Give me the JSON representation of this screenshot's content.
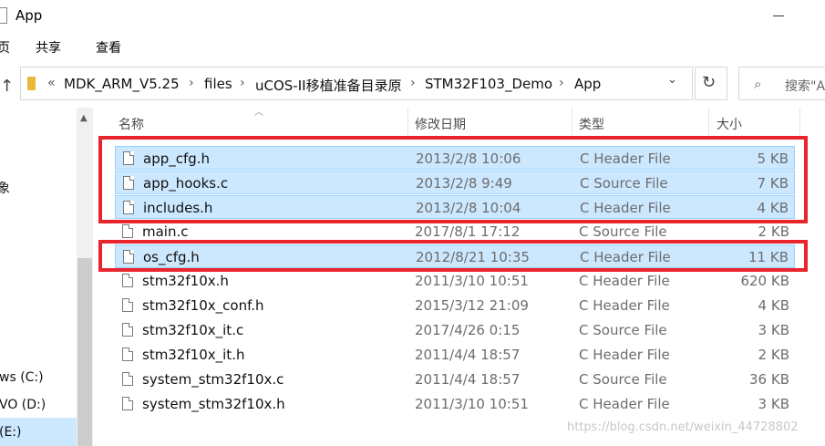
{
  "window": {
    "title": "App"
  },
  "ribbon": {
    "tabs": [
      "页",
      "共享",
      "查看"
    ]
  },
  "address": {
    "lead": "«",
    "crumbs": [
      "MDK_ARM_V5.25",
      "files",
      "uCOS-II移植准备目录原",
      "STM32F103_Demo",
      "App"
    ]
  },
  "search": {
    "placeholder": "搜索\"A"
  },
  "nav": {
    "items": [
      "象",
      "ws (C:)",
      "VO (D:)",
      "(E:)"
    ]
  },
  "columns": {
    "name": "名称",
    "date": "修改日期",
    "type": "类型",
    "size": "大小"
  },
  "files": [
    {
      "name": "app_cfg.h",
      "date": "2013/2/8 10:06",
      "type": "C Header File",
      "size": "5 KB"
    },
    {
      "name": "app_hooks.c",
      "date": "2013/2/8 9:49",
      "type": "C Source File",
      "size": "7 KB"
    },
    {
      "name": "includes.h",
      "date": "2013/2/8 10:04",
      "type": "C Header File",
      "size": "4 KB"
    },
    {
      "name": "main.c",
      "date": "2017/8/1 17:12",
      "type": "C Source File",
      "size": "2 KB"
    },
    {
      "name": "os_cfg.h",
      "date": "2012/8/21 10:35",
      "type": "C Header File",
      "size": "11 KB"
    },
    {
      "name": "stm32f10x.h",
      "date": "2011/3/10 10:51",
      "type": "C Header File",
      "size": "620 KB"
    },
    {
      "name": "stm32f10x_conf.h",
      "date": "2015/3/12 21:09",
      "type": "C Header File",
      "size": "4 KB"
    },
    {
      "name": "stm32f10x_it.c",
      "date": "2017/4/26 0:15",
      "type": "C Source File",
      "size": "3 KB"
    },
    {
      "name": "stm32f10x_it.h",
      "date": "2011/4/4 18:57",
      "type": "C Header File",
      "size": "2 KB"
    },
    {
      "name": "system_stm32f10x.c",
      "date": "2011/4/4 18:57",
      "type": "C Source File",
      "size": "36 KB"
    },
    {
      "name": "system_stm32f10x.h",
      "date": "2011/3/10 10:51",
      "type": "C Header File",
      "size": "3 KB"
    }
  ],
  "selected_rows": [
    0,
    1,
    2,
    4
  ],
  "watermark": "https://blog.csdn.net/weixin_44728802",
  "colors": {
    "selection": "#cce8ff",
    "highlight_box": "#e8252c",
    "folder": "#e8b83a"
  }
}
